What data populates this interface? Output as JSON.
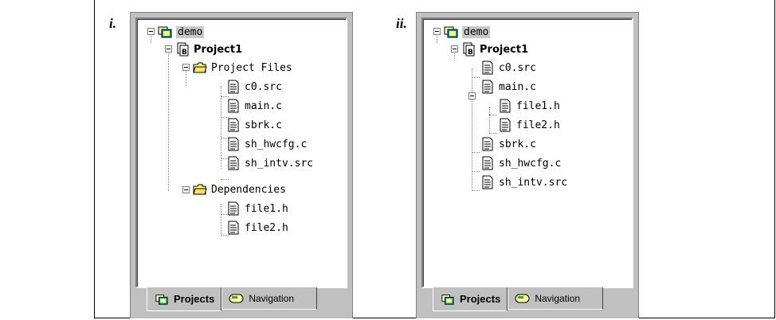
{
  "labels": {
    "left": "i.",
    "right": "ii."
  },
  "left": {
    "root": "demo",
    "project": "Project1",
    "folder_files": "Project Files",
    "files": [
      "c0.src",
      "main.c",
      "sbrk.c",
      "sh_hwcfg.c",
      "sh_intv.src"
    ],
    "folder_deps": "Dependencies",
    "deps": [
      "file1.h",
      "file2.h"
    ],
    "tabs": {
      "projects": "Projects",
      "navigation": "Navigation"
    }
  },
  "right": {
    "root": "demo",
    "project": "Project1",
    "c0": "c0.src",
    "main": "main.c",
    "main_children": [
      "file1.h",
      "file2.h"
    ],
    "after": [
      "sbrk.c",
      "sh_hwcfg.c",
      "sh_intv.src"
    ],
    "tabs": {
      "projects": "Projects",
      "navigation": "Navigation"
    }
  }
}
